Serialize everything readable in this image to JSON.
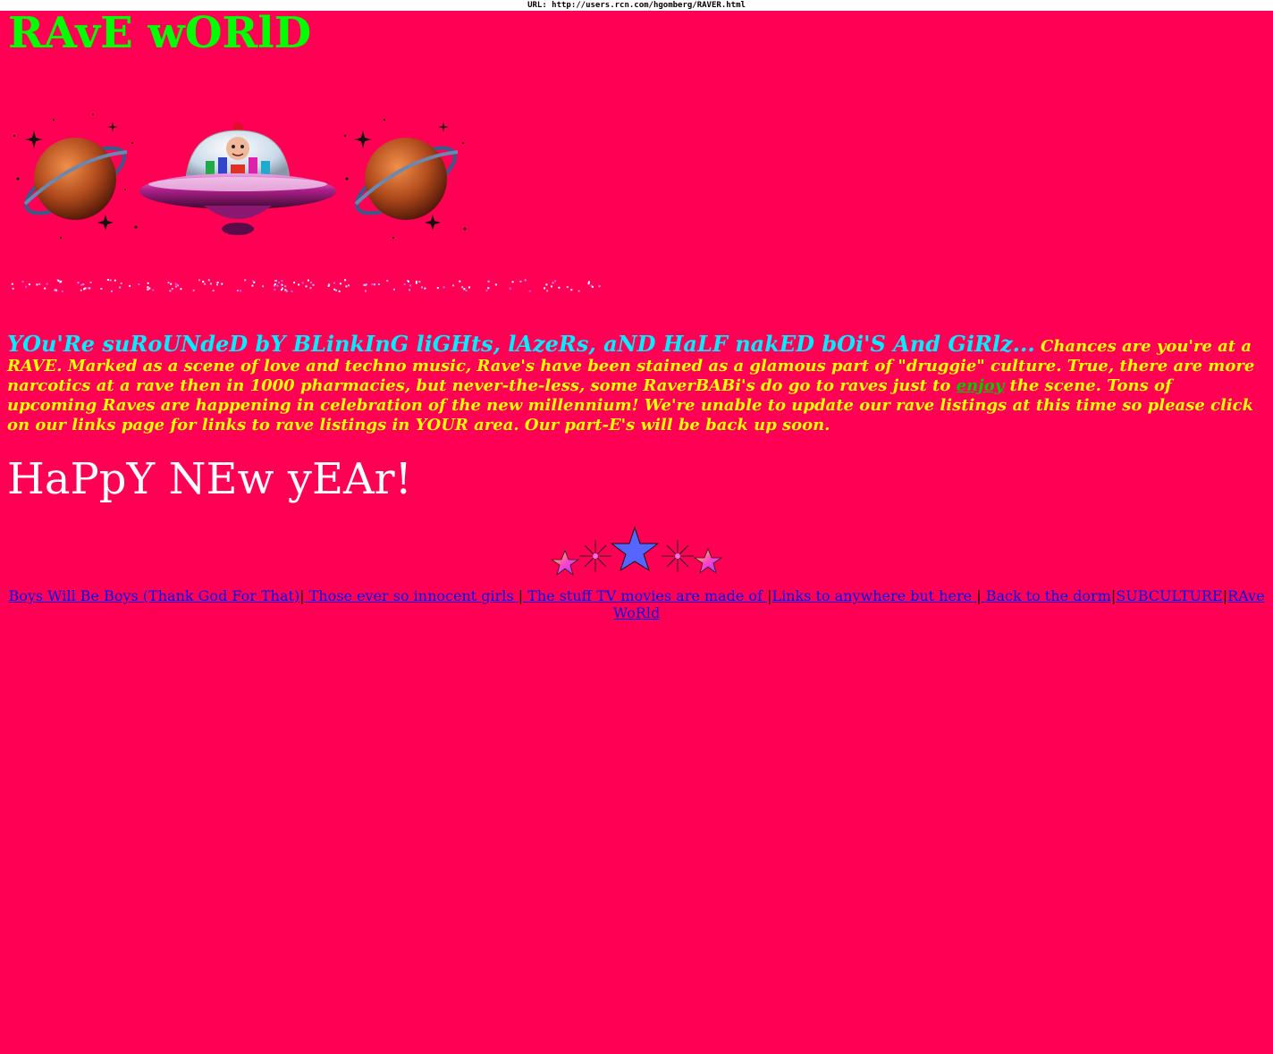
{
  "url_bar": {
    "text": "URL: http://users.rcn.com/hgomberg/RAVER.html"
  },
  "header": {
    "title": "RAvE wORlD"
  },
  "colors": {
    "background": "#ff0055",
    "title": "#00ff00",
    "lead_text": "#00eeff",
    "body_text": "#ffff00",
    "link_inline": "#00cc00",
    "heading_white": "#ffffff",
    "nav_link": "#0000ee"
  },
  "banner": {
    "icons": [
      "ringed-planet-icon",
      "ufo-flying-saucer-icon",
      "ringed-planet-icon"
    ]
  },
  "intro": {
    "lead": "YOu'Re suRoUNdeD bY BLinkInG liGHts, lAzeRs, aND HaLF nakED bOi'S And GiRlz...",
    "text_before_link": " Chances are you're at a RAVE. Marked as a scene of love and techno music, Rave's have been stained as a glamous part of \"druggie\" culture. True, there are more narcotics at a rave then in 1000 pharmacies, but never-the-less, some RaverBABi's do go to raves just to ",
    "link_text": "enjoy",
    "text_after_link": " the scene. Tons of upcoming Raves are happening in celebration of the new millennium! We're unable to update our rave listings at this time so please click on our links page for links to rave listings in YOUR area. Our part-E's will be back up soon."
  },
  "new_year": {
    "text": "HaPpY NEw yEAr!"
  },
  "nav": {
    "links": [
      "Boys Will Be Boys (Thank God For That)",
      " Those ever so innocent girls ",
      " The stuff TV movies are made of ",
      "Links to anywhere but here ",
      " Back to the dorm",
      "SUBCULTURE",
      "RAve WoRld"
    ],
    "separator": "|"
  }
}
